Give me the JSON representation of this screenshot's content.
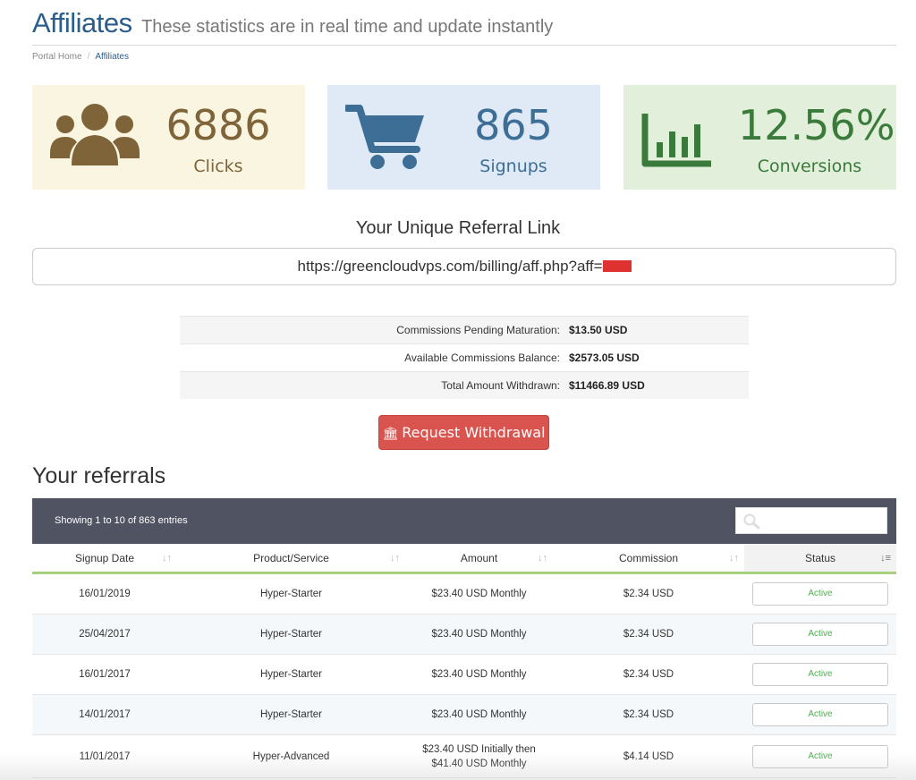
{
  "header": {
    "title": "Affiliates",
    "subtitle": "These statistics are in real time and update instantly"
  },
  "breadcrumb": {
    "home": "Portal Home",
    "separator": "/",
    "current": "Affiliates"
  },
  "stats": {
    "clicks": {
      "value": "6886",
      "label": "Clicks",
      "icon": "users-icon",
      "color": "#7f6339",
      "bg": "#f9f5e1"
    },
    "signups": {
      "value": "865",
      "label": "Signups",
      "icon": "shopping-cart-icon",
      "color": "#3c6e96",
      "bg": "#dfeaf6"
    },
    "conversions": {
      "value": "12.56%",
      "label": "Conversions",
      "icon": "bar-chart-icon",
      "color": "#3a7a3a",
      "bg": "#e1efdb"
    }
  },
  "referral": {
    "title": "Your Unique Referral Link",
    "link": "https://greencloudvps.com/billing/aff.php?aff="
  },
  "commissions": [
    {
      "label": "Commissions Pending Maturation:",
      "value": "$13.50 USD"
    },
    {
      "label": "Available Commissions Balance:",
      "value": "$2573.05 USD"
    },
    {
      "label": "Total Amount Withdrawn:",
      "value": "$11466.89 USD"
    }
  ],
  "withdraw_button": {
    "label": "Request Withdrawal",
    "icon": "bank-icon",
    "color": "#d9534f"
  },
  "referrals": {
    "title": "Your referrals",
    "entries_info": "Showing 1 to 10 of 863 entries",
    "columns": [
      "Signup Date",
      "Product/Service",
      "Amount",
      "Commission",
      "Status"
    ],
    "rows": [
      {
        "date": "16/01/2019",
        "product": "Hyper-Starter",
        "amount": "$23.40 USD Monthly",
        "commission": "$2.34 USD",
        "status": "Active"
      },
      {
        "date": "25/04/2017",
        "product": "Hyper-Starter",
        "amount": "$23.40 USD Monthly",
        "commission": "$2.34 USD",
        "status": "Active"
      },
      {
        "date": "16/01/2017",
        "product": "Hyper-Starter",
        "amount": "$23.40 USD Monthly",
        "commission": "$2.34 USD",
        "status": "Active"
      },
      {
        "date": "14/01/2017",
        "product": "Hyper-Starter",
        "amount": "$23.40 USD Monthly",
        "commission": "$2.34 USD",
        "status": "Active"
      },
      {
        "date": "11/01/2017",
        "product": "Hyper-Advanced",
        "amount": "$23.40 USD Initially then",
        "amount2": "$41.40 USD Monthly",
        "commission": "$4.14 USD",
        "status": "Active"
      }
    ]
  },
  "accent_colors": {
    "header_title": "#2b5e8c",
    "table_bar": "#505462",
    "status_active": "#4caf50",
    "column_underline": "#a6d07e"
  }
}
